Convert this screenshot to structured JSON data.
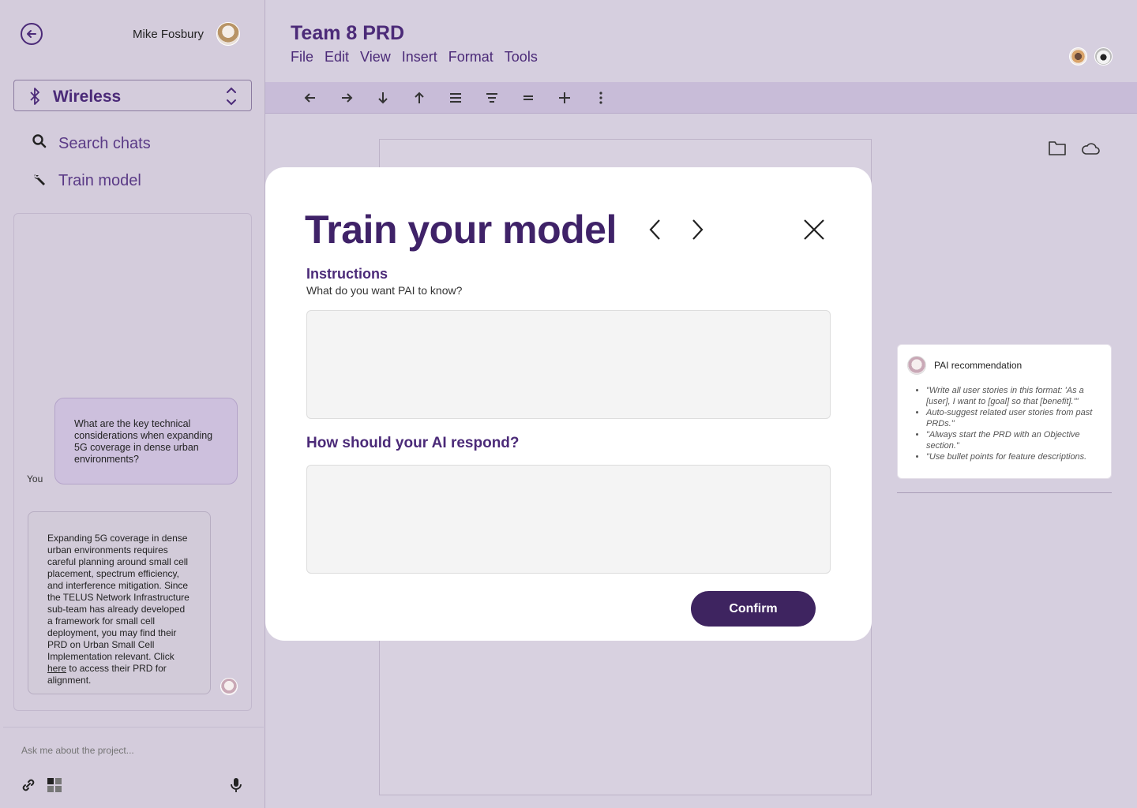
{
  "user": {
    "name": "Mike Fosbury"
  },
  "network": {
    "label": "Wireless"
  },
  "nav": {
    "search": "Search chats",
    "train": "Train model"
  },
  "chat": {
    "you_label": "You",
    "user_message": "What are the key technical considerations when expanding 5G coverage in dense urban environments?",
    "ai_message_pre": "Expanding 5G coverage in dense urban environments requires careful planning around small cell placement, spectrum efficiency, and interference mitigation. Since the TELUS Network Infrastructure sub-team has already developed a framework for small cell deployment, you may find their PRD on Urban Small Cell Implementation relevant. Click ",
    "ai_link": "here",
    "ai_message_post": " to access their PRD for alignment.",
    "input_placeholder": "Ask me about the project..."
  },
  "doc": {
    "title": "Team 8 PRD",
    "menu": [
      "File",
      "Edit",
      "View",
      "Insert",
      "Format",
      "Tools"
    ]
  },
  "toolbar_icons": [
    "arrow-left-icon",
    "arrow-right-icon",
    "arrow-down-icon",
    "arrow-up-icon",
    "align-justify-icon",
    "align-center-icon",
    "equals-icon",
    "plus-icon",
    "more-vertical-icon"
  ],
  "recommendation": {
    "title": "PAI recommendation",
    "items": [
      "\"Write all user stories in this format: 'As a [user], I want to [goal] so that [benefit].'\"",
      "Auto-suggest related user stories from past PRDs.\"",
      "\"Always start the PRD with an Objective section.\"",
      "\"Use bullet points for feature descriptions."
    ]
  },
  "modal": {
    "title": "Train your model",
    "instructions_heading": "Instructions",
    "instructions_sub": "What do you want PAI to know?",
    "instructions_value": "",
    "respond_heading": "How should your AI respond?",
    "respond_value": "",
    "confirm_label": "Confirm"
  },
  "colors": {
    "accent": "#4b2a78",
    "button": "#3e2460",
    "background": "#d6cfdf"
  }
}
